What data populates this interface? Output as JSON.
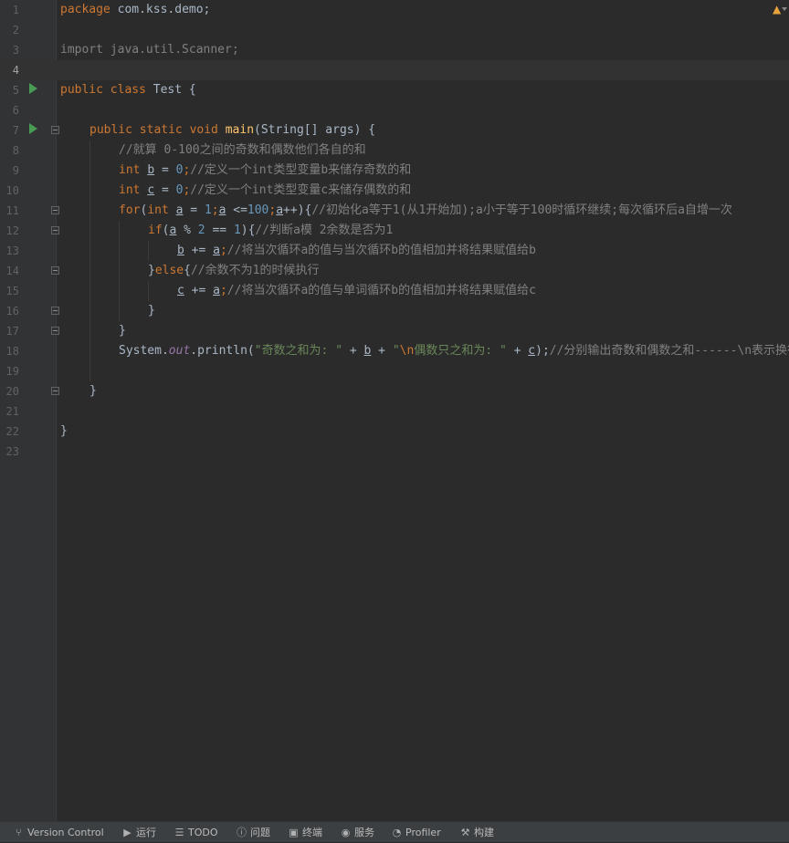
{
  "editor": {
    "lines": [
      {
        "num": "1"
      },
      {
        "num": "2"
      },
      {
        "num": "3"
      },
      {
        "num": "4"
      },
      {
        "num": "5"
      },
      {
        "num": "6"
      },
      {
        "num": "7"
      },
      {
        "num": "8"
      },
      {
        "num": "9"
      },
      {
        "num": "10"
      },
      {
        "num": "11"
      },
      {
        "num": "12"
      },
      {
        "num": "13"
      },
      {
        "num": "14"
      },
      {
        "num": "15"
      },
      {
        "num": "16"
      },
      {
        "num": "17"
      },
      {
        "num": "18"
      },
      {
        "num": "19"
      },
      {
        "num": "20"
      },
      {
        "num": "21"
      },
      {
        "num": "22"
      },
      {
        "num": "23"
      }
    ],
    "current_line": "4",
    "code": {
      "l1_kw": "package",
      "l1_rest": " com.kss.demo;",
      "l3": "import java.util.Scanner;",
      "l5_kw": "public class",
      "l5_rest": " Test {",
      "l7_kw": "public static void",
      "l7_fn": "main",
      "l7_rest": "(String[] args) {",
      "l8_cm": "//就算 0-100之间的奇数和偶数他们各自的和",
      "l9_kw": "int",
      "l9_var": "b",
      "l9_eq": " = ",
      "l9_num": "0",
      "l9_semi": ";",
      "l9_cm": "//定义一个int类型变量b来储存奇数的和",
      "l10_kw": "int",
      "l10_var": "c",
      "l10_eq": " = ",
      "l10_num": "0",
      "l10_semi": ";",
      "l10_cm": "//定义一个int类型变量c来储存偶数的和",
      "l11_for": "for",
      "l11_open": "(",
      "l11_int": "int",
      "l11_a1": "a",
      "l11_eq": " = ",
      "l11_n1": "1",
      "l11_s1": ";",
      "l11_a2": "a",
      "l11_le": " <=",
      "l11_n2": "100",
      "l11_s2": ";",
      "l11_a3": "a",
      "l11_inc": "++){",
      "l11_cm": "//初始化a等于1(从1开始加);a小于等于100时循环继续;每次循环后a自增一次",
      "l12_if": "if",
      "l12_open": "(",
      "l12_a": "a",
      "l12_mod": " % ",
      "l12_n1": "2",
      "l12_eqeq": " == ",
      "l12_n2": "1",
      "l12_close": "){",
      "l12_cm": "//判断a模 2余数是否为1",
      "l13_b": "b",
      "l13_op": " += ",
      "l13_a": "a",
      "l13_semi": ";",
      "l13_cm": "//将当次循环a的值与当次循环b的值相加并将结果赋值给b",
      "l14_br": "}",
      "l14_else": "else",
      "l14_open": "{",
      "l14_cm": "//余数不为1的时候执行",
      "l15_c": "c",
      "l15_op": " += ",
      "l15_a": "a",
      "l15_semi": ";",
      "l15_cm": "//将当次循环a的值与单词循环b的值相加并将结果赋值给c",
      "l16": "}",
      "l17": "}",
      "l18_sys": "System.",
      "l18_out": "out",
      "l18_println": ".println(",
      "l18_s1": "\"奇数之和为: \"",
      "l18_plus1": " + ",
      "l18_b": "b",
      "l18_plus2": " + ",
      "l18_q": "\"",
      "l18_esc": "\\n",
      "l18_s2": "偶数只之和为: \"",
      "l18_plus3": " + ",
      "l18_c": "c",
      "l18_close": ");",
      "l18_cm": "//分别输出奇数和偶数之和------\\n表示换行",
      "l20": "}",
      "l22": "}"
    },
    "warning_glyph": "▲"
  },
  "statusbar": {
    "items": [
      {
        "icon": "branch-icon",
        "glyph": "⑂",
        "label": "Version Control"
      },
      {
        "icon": "run-icon",
        "glyph": "▶",
        "label": "运行"
      },
      {
        "icon": "list-icon",
        "glyph": "☰",
        "label": "TODO"
      },
      {
        "icon": "problems-icon",
        "glyph": "ⓘ",
        "label": "问题"
      },
      {
        "icon": "terminal-icon",
        "glyph": "▣",
        "label": "终端"
      },
      {
        "icon": "services-icon",
        "glyph": "◉",
        "label": "服务"
      },
      {
        "icon": "profiler-icon",
        "glyph": "◔",
        "label": "Profiler"
      },
      {
        "icon": "build-icon",
        "glyph": "⚒",
        "label": "构建"
      }
    ]
  },
  "colors": {
    "background": "#2b2b2b",
    "keyword": "#cc7832",
    "method": "#ffc66d",
    "number": "#6897bb",
    "string": "#6a8759",
    "comment": "#808080",
    "run_gutter": "#499c54"
  }
}
